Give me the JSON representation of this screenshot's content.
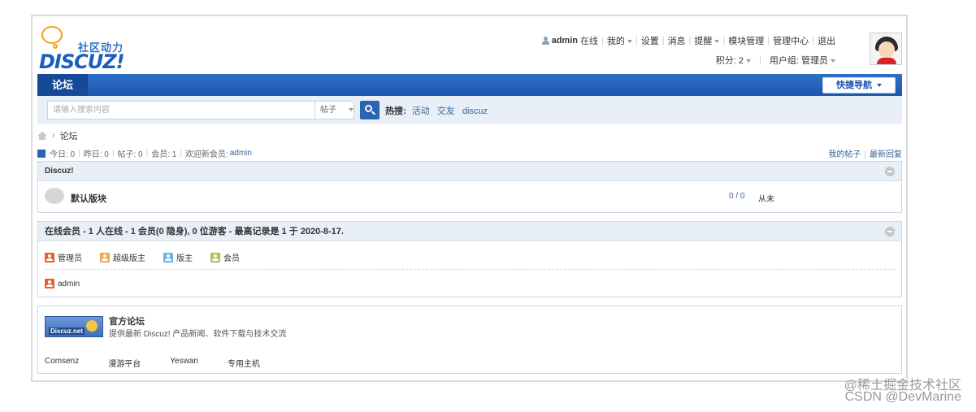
{
  "logo": {
    "tagline": "社区动力",
    "wordmark": "DISCUZ!"
  },
  "user_nav": {
    "username": "admin",
    "status": "在线",
    "items": [
      "我的",
      "设置",
      "消息",
      "提醒",
      "模块管理",
      "管理中心",
      "退出"
    ],
    "credits": "积分: 2",
    "group": "用户组: 管理员"
  },
  "nav": {
    "tab": "论坛",
    "quick_nav": "快捷导航"
  },
  "search": {
    "placeholder": "请输入搜索内容",
    "type": "帖子",
    "hot_label": "热搜:",
    "hot_terms": [
      "活动",
      "交友",
      "discuz"
    ]
  },
  "breadcrumb": {
    "current": "论坛"
  },
  "stats": {
    "today": "今日: 0",
    "yesterday": "昨日: 0",
    "posts": "帖子: 0",
    "members": "会员: 1",
    "welcome": "欢迎新会员:",
    "new_member": "admin",
    "my_posts": "我的帖子",
    "latest_replies": "最新回复"
  },
  "category": {
    "title": "Discuz!",
    "forum_name": "默认版块",
    "counts": "0 / 0",
    "last_post": "从未"
  },
  "online": {
    "header": "在线会员 - 1 人在线 - 1 会员(0 隐身), 0 位游客 - 最高记录是 1 于 2020-8-17.",
    "legend": [
      {
        "label": "管理员",
        "color": "#e8632b"
      },
      {
        "label": "超级版主",
        "color": "#f0a848"
      },
      {
        "label": "版主",
        "color": "#6cb4e6"
      },
      {
        "label": "会员",
        "color": "#a7c94a"
      }
    ],
    "members": [
      {
        "name": "admin",
        "color": "#e8632b"
      }
    ]
  },
  "links": {
    "image_label": "Discuz.net",
    "title": "官方论坛",
    "description": "提供最新 Discuz! 产品新闻、软件下载与技术交流",
    "partners": [
      "Comsenz",
      "漫游平台",
      "Yeswan",
      "专用主机"
    ]
  },
  "watermark": {
    "line1": "@稀土掘金技术社区",
    "line2": "CSDN @DevMarine"
  }
}
